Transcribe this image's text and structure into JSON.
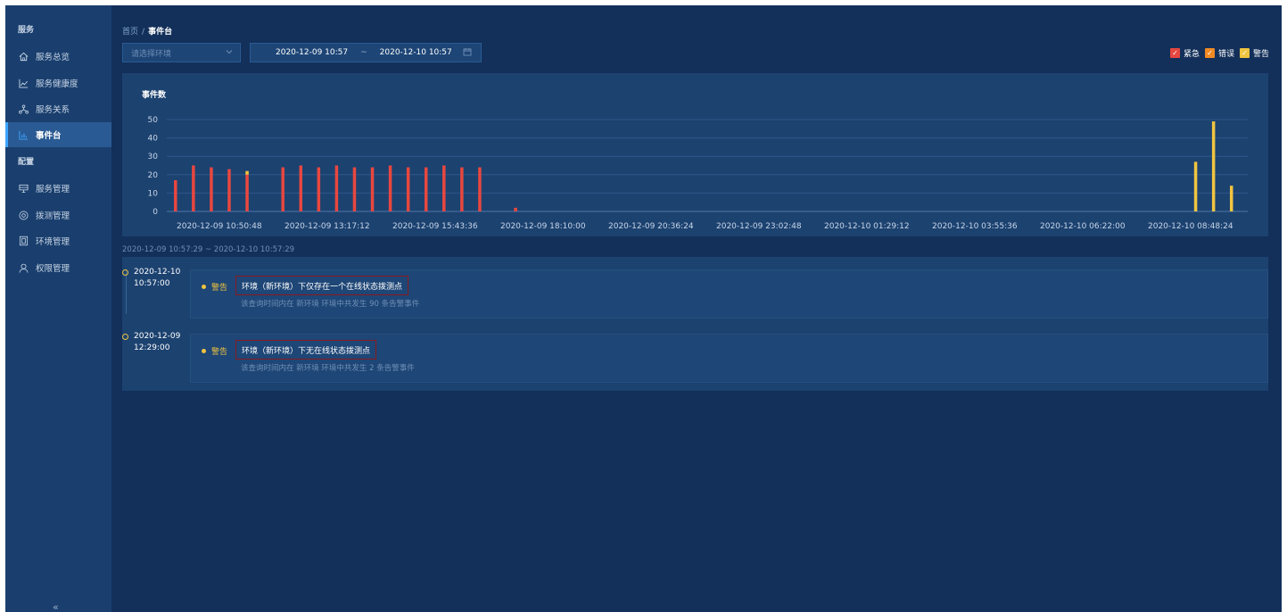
{
  "sidebar": {
    "section_service": "服务",
    "section_config": "配置",
    "items": [
      {
        "label": "服务总览",
        "icon": "home-icon"
      },
      {
        "label": "服务健康度",
        "icon": "line-chart-icon"
      },
      {
        "label": "服务关系",
        "icon": "topology-icon"
      },
      {
        "label": "事件台",
        "icon": "bar-chart-icon",
        "active": true
      },
      {
        "label": "服务管理",
        "icon": "server-icon"
      },
      {
        "label": "拨测管理",
        "icon": "probe-icon"
      },
      {
        "label": "环境管理",
        "icon": "environment-icon"
      },
      {
        "label": "权限管理",
        "icon": "user-icon"
      }
    ],
    "collapse_label": "«"
  },
  "breadcrumb": {
    "home": "首页",
    "separator": "/",
    "current": "事件台"
  },
  "filters": {
    "env_placeholder": "请选择环境",
    "start": "2020-12-09 10:57",
    "tilde": "~",
    "end": "2020-12-10 10:57"
  },
  "legend": [
    {
      "label": "紧急",
      "color": "#e8473f"
    },
    {
      "label": "错误",
      "color": "#f08a24"
    },
    {
      "label": "警告",
      "color": "#f0c440"
    }
  ],
  "chart_data": {
    "type": "bar",
    "title": "事件数",
    "ylim": [
      0,
      50
    ],
    "yticks": [
      0,
      10,
      20,
      30,
      40,
      50
    ],
    "xtick_labels": [
      "2020-12-09 10:50:48",
      "2020-12-09 13:17:12",
      "2020-12-09 15:43:36",
      "2020-12-09 18:10:00",
      "2020-12-09 20:36:24",
      "2020-12-09 23:02:48",
      "2020-12-10 01:29:12",
      "2020-12-10 03:55:36",
      "2020-12-10 06:22:00",
      "2020-12-10 08:48:24"
    ],
    "series": [
      {
        "name": "紧急",
        "color": "#e8473f",
        "values": [
          17,
          25,
          24,
          23,
          22,
          0,
          24,
          25,
          24,
          25,
          24,
          24,
          25,
          24,
          24,
          25,
          24,
          24,
          0,
          2,
          0,
          0,
          0,
          0,
          0,
          0,
          0,
          0,
          0,
          0,
          0,
          0,
          0,
          0,
          0,
          0,
          0,
          0,
          0,
          0,
          0,
          0,
          0,
          0,
          0,
          0,
          0,
          0,
          0,
          0,
          0,
          0,
          0,
          0,
          0,
          0,
          0,
          0,
          0,
          0
        ]
      },
      {
        "name": "警告",
        "color": "#f0c440",
        "values": [
          0,
          0,
          0,
          0,
          0,
          0,
          0,
          0,
          0,
          0,
          0,
          0,
          0,
          0,
          0,
          0,
          0,
          0,
          0,
          0,
          0,
          0,
          0,
          0,
          0,
          0,
          0,
          0,
          0,
          0,
          0,
          0,
          0,
          0,
          0,
          0,
          0,
          0,
          0,
          0,
          0,
          0,
          0,
          0,
          0,
          0,
          0,
          0,
          0,
          0,
          0,
          0,
          0,
          0,
          0,
          0,
          0,
          27,
          49,
          14
        ]
      },
      {
        "name": "错误",
        "color": "#f08a24",
        "values": [
          0,
          0,
          0,
          0,
          0,
          0,
          0,
          0,
          0,
          0,
          0,
          0,
          0,
          0,
          0,
          0,
          0,
          0,
          0,
          0,
          0,
          0,
          0,
          0,
          0,
          0,
          0,
          0,
          0,
          0,
          0,
          0,
          0,
          0,
          0,
          0,
          0,
          0,
          0,
          0,
          0,
          0,
          0,
          0,
          0,
          0,
          0,
          0,
          0,
          0,
          0,
          0,
          0,
          0,
          0,
          0,
          0,
          0,
          0,
          0
        ]
      }
    ],
    "mixed_bar": {
      "index": 4,
      "red": 20,
      "yellow": 2
    }
  },
  "range_label": "2020-12-09 10:57:29 ~ 2020-12-10 10:57:29",
  "events": [
    {
      "date": "2020-12-10",
      "time": "10:57:00",
      "level": "警告",
      "title": "环境（新环境）下仅存在一个在线状态拨测点",
      "desc": "该查询时间内在  新环境  环境中共发生  90  条告警事件"
    },
    {
      "date": "2020-12-09",
      "time": "12:29:00",
      "level": "警告",
      "title": "环境（新环境）下无在线状态拨测点",
      "desc": "该查询时间内在  新环境  环境中共发生  2  条告警事件"
    }
  ]
}
